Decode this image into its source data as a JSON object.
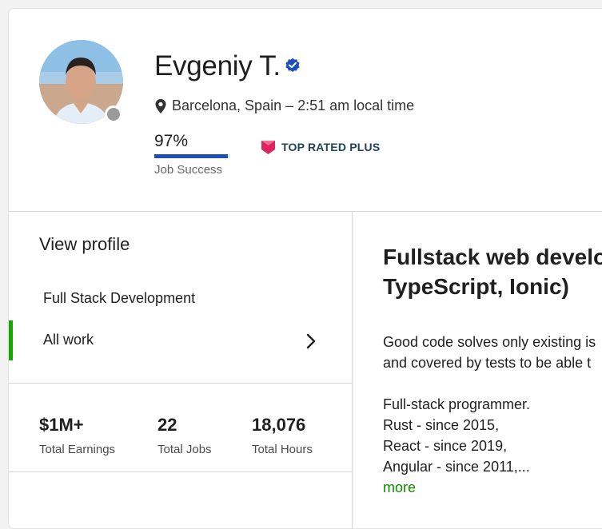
{
  "header": {
    "name": "Evgeniy T.",
    "location": "Barcelona, Spain – 2:51 am local time",
    "job_success": {
      "value": "97%",
      "fraction": 0.97,
      "label": "Job Success"
    },
    "badge": "TOP RATED PLUS",
    "status": "offline"
  },
  "sidebar": {
    "view_profile": "View profile",
    "specialty": "Full Stack Development",
    "all_work": "All work"
  },
  "stats": [
    {
      "value": "$1M+",
      "label": "Total Earnings"
    },
    {
      "value": "22",
      "label": "Total Jobs"
    },
    {
      "value": "18,076",
      "label": "Total Hours"
    }
  ],
  "profile": {
    "title_line1": "Fullstack web develo",
    "title_line2": "TypeScript, Ionic)",
    "desc_lines": [
      "Good code solves only existing is",
      "and covered by tests to be able t",
      "",
      "Full-stack programmer.",
      "Rust - since 2015,",
      "React - since 2019,",
      "Angular - since 2011,..."
    ],
    "more": "more"
  },
  "colors": {
    "accent_green": "#14a800",
    "link_green": "#108a00",
    "progress_blue": "#1c4fb8",
    "verified_blue": "#1c4fb8",
    "badge_pink": "#e0235f",
    "status_gray": "#9a9a9a"
  },
  "icons": {
    "verified": "verified-badge-icon",
    "location": "map-pin-icon",
    "badge": "top-rated-shield-icon",
    "chevron": "chevron-right-icon"
  }
}
